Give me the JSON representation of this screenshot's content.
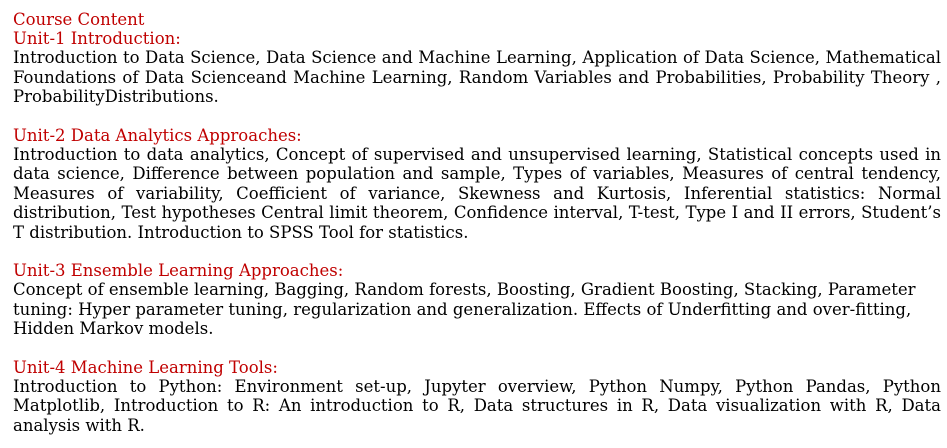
{
  "document": {
    "title": "Course Content",
    "units": [
      {
        "heading": "Unit-1 Introduction:",
        "text": "Introduction to Data Science, Data Science and Machine Learning, Application of Data Science, Mathematical Foundations of Data Scienceand Machine Learning, Random Variables and Probabilities, Probability Theory , ProbabilityDistributions."
      },
      {
        "heading": "Unit-2 Data Analytics Approaches:",
        "text": "Introduction to data analytics, Concept of supervised and unsupervised learning, Statistical concepts used in data science, Difference between population and sample, Types of variables, Measures of central tendency, Measures of variability, Coefficient of variance, Skewness and Kurtosis, Inferential statistics: Normal distribution, Test hypotheses Central limit theorem, Confidence interval, T-test, Type I and II errors, Student’s T distribution. Introduction to SPSS Tool for statistics."
      },
      {
        "heading": "Unit-3 Ensemble Learning Approaches:",
        "text": "Concept of ensemble learning, Bagging, Random forests, Boosting, Gradient Boosting, Stacking, Parameter tuning: Hyper parameter tuning, regularization and generalization. Effects of Underfitting and over-fitting, Hidden Markov models."
      },
      {
        "heading": "Unit-4 Machine Learning Tools:",
        "text": "Introduction to Python: Environment set-up, Jupyter overview, Python Numpy, Python Pandas, Python Matplotlib, Introduction to R: An introduction to R, Data structures in R, Data visualization with R, Data analysis with R."
      }
    ]
  }
}
